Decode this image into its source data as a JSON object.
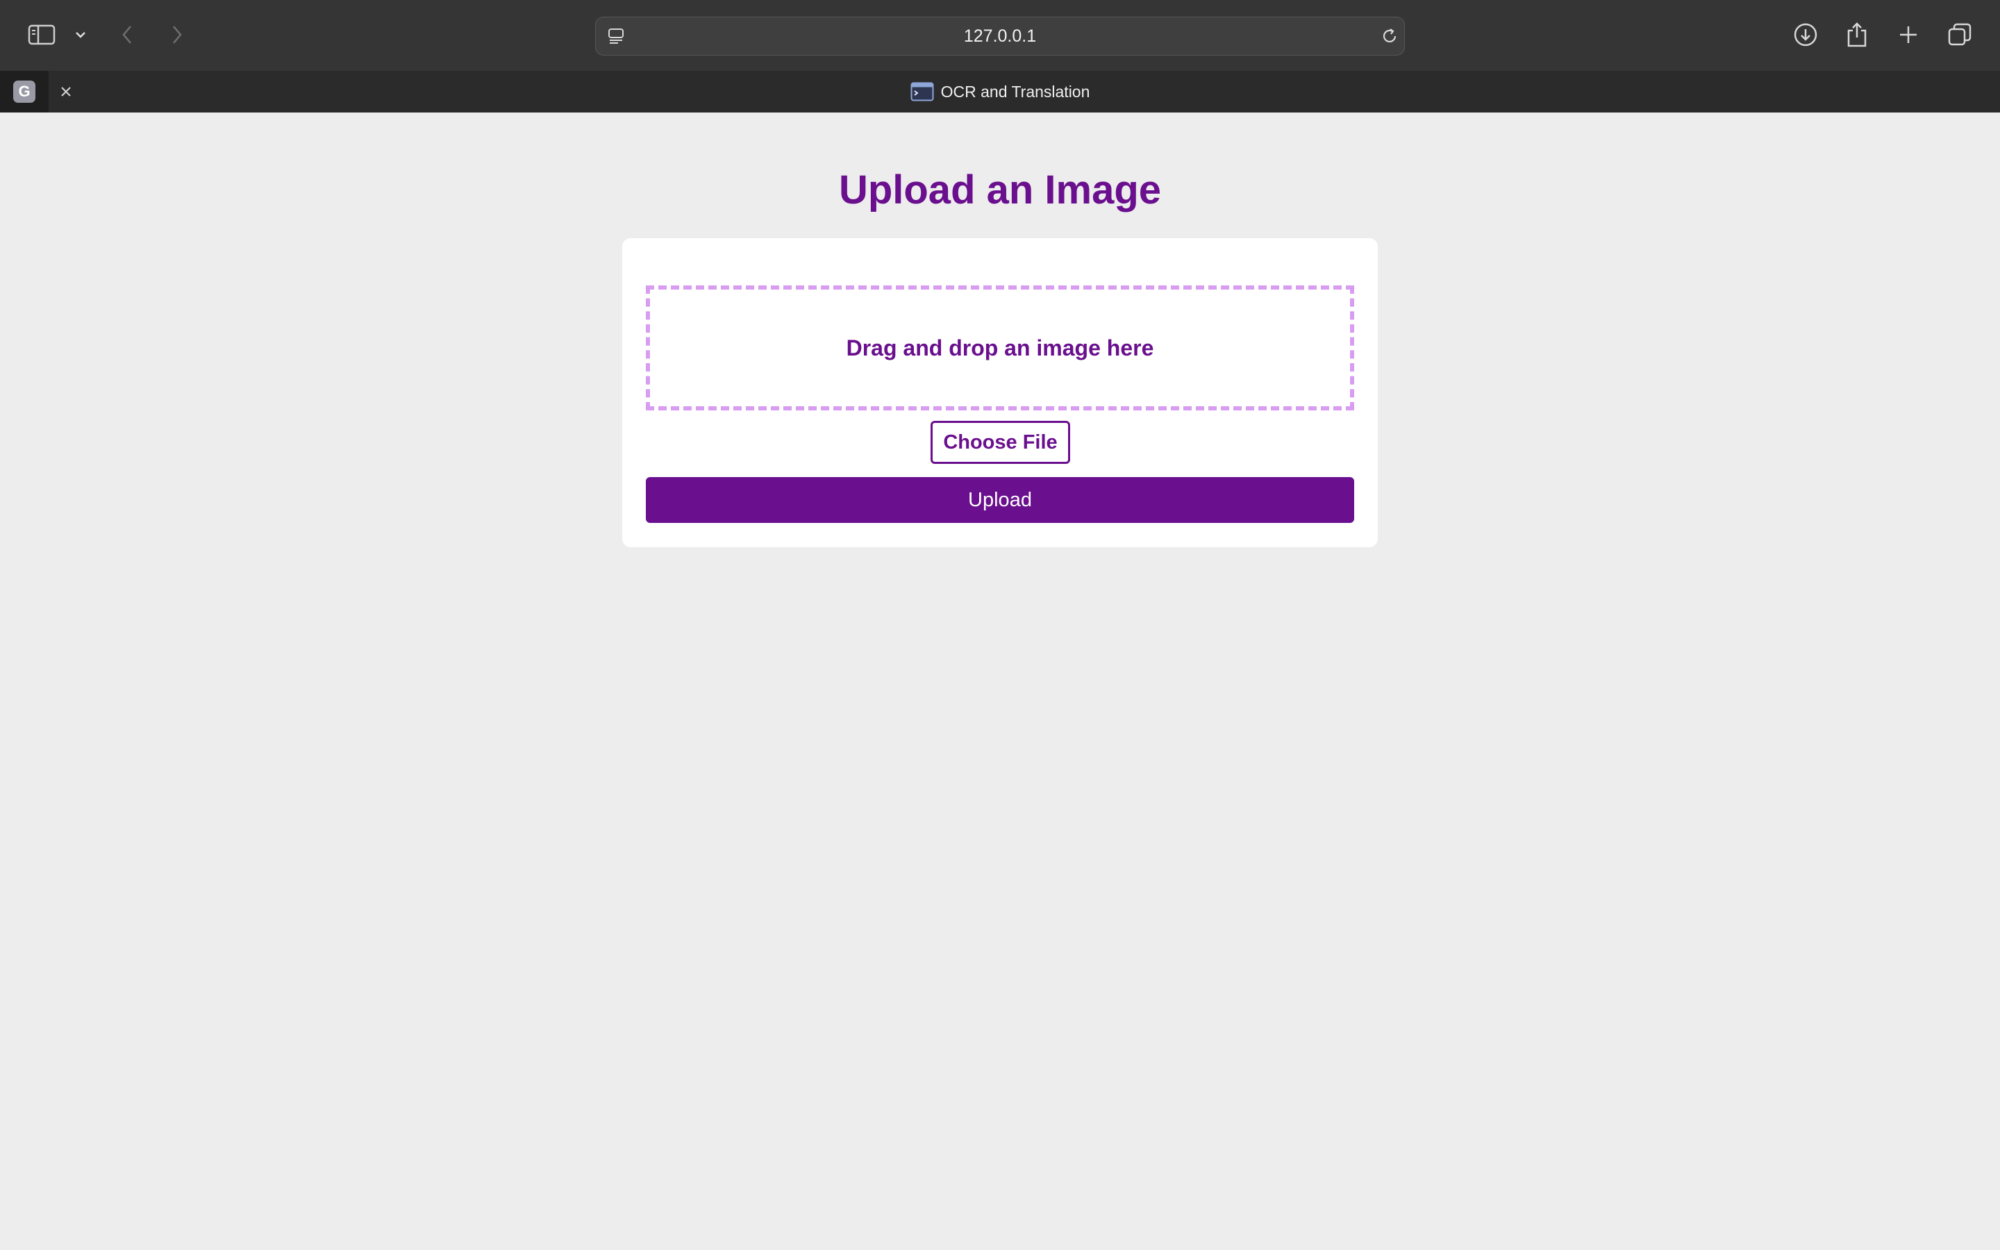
{
  "browser": {
    "address": "127.0.0.1",
    "pinned_tab": {
      "favicon_letter": "G"
    },
    "active_tab": {
      "title": "OCR and Translation",
      "favicon": "terminal-icon"
    },
    "toolbar_icons": [
      "sidebar-icon",
      "chevron-down-icon",
      "back-icon",
      "forward-icon",
      "reader-icon",
      "reload-icon",
      "download-icon",
      "share-icon",
      "new-tab-icon",
      "tab-overview-icon"
    ]
  },
  "page": {
    "title": "Upload an Image",
    "dropzone_text": "Drag and drop an image here",
    "choose_file_label": "Choose File",
    "upload_label": "Upload"
  },
  "colors": {
    "accent": "#6a0f8e",
    "dropzone_border": "#d89cf0",
    "page_background": "#ededed",
    "card_background": "#ffffff"
  }
}
